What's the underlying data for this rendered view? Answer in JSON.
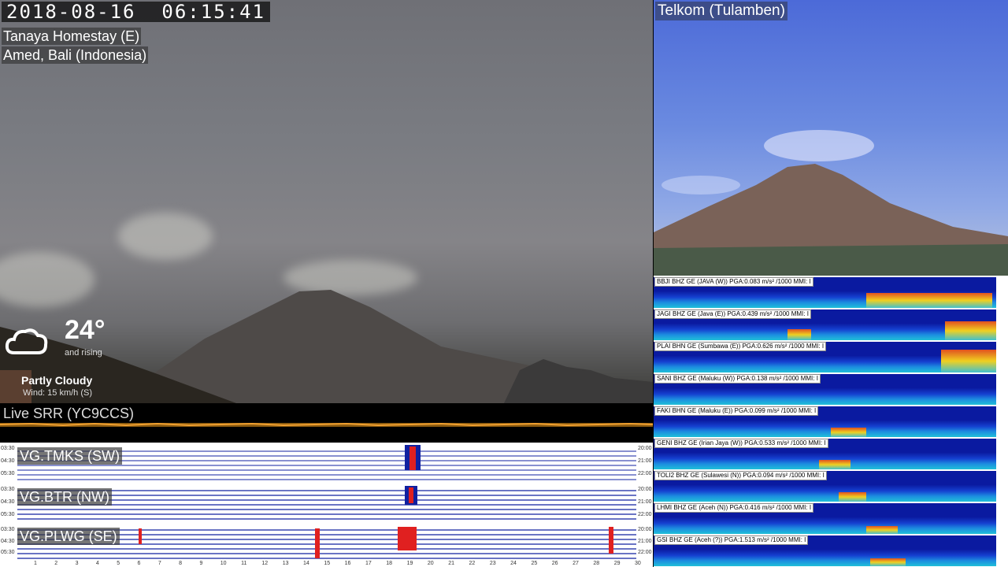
{
  "clock": "2018-08-16  06:15:41",
  "left_camera": {
    "location_line1": "Tanaya Homestay (E)",
    "location_line2": "Amed, Bali (Indonesia)"
  },
  "weather": {
    "icon": "partly-cloudy-icon",
    "temperature": "24°",
    "trend": "and rising",
    "condition": "Partly Cloudy",
    "wind": "Wind: 15 km/h (S)"
  },
  "right_camera": {
    "label": "Telkom (Tulamben)"
  },
  "srr": {
    "label": "Live SRR (YC9CCS)"
  },
  "seismograms": {
    "stations": [
      {
        "label": "VG.TMKS (SW)",
        "times_left": [
          "03:30",
          "04:30",
          "05:30"
        ],
        "times_right": [
          "20:00",
          "21:00",
          "22:00"
        ]
      },
      {
        "label": "VG.BTR (NW)",
        "times_left": [
          "03:30",
          "04:30",
          "05:30"
        ],
        "times_right": [
          "20:00",
          "21:00",
          "22:00"
        ]
      },
      {
        "label": "VG.PLWG (SE)",
        "times_left": [
          "03:30",
          "04:30",
          "05:30"
        ],
        "times_right": [
          "20:00",
          "21:00",
          "22:00"
        ]
      }
    ],
    "x_ticks": [
      "1",
      "2",
      "3",
      "4",
      "5",
      "6",
      "7",
      "8",
      "9",
      "10",
      "11",
      "12",
      "13",
      "14",
      "15",
      "16",
      "17",
      "18",
      "19",
      "20",
      "21",
      "22",
      "23",
      "24",
      "25",
      "26",
      "27",
      "28",
      "29",
      "30"
    ]
  },
  "spectrograms": [
    {
      "label": "BBJI BHZ GE (JAVA (W)) PGA:0.083 m/s² /1000 MMI: I"
    },
    {
      "label": "JAGI BHZ GE (Java (E)) PGA:0.439 m/s² /1000 MMI: I"
    },
    {
      "label": "PLAI BHN GE (Sumbawa (E)) PGA:0.626 m/s² /1000 MMI: I"
    },
    {
      "label": "SANI BHZ GE (Maluku (W)) PGA:0.138 m/s² /1000 MMI: I"
    },
    {
      "label": "FAKI BHN GE (Maluku (E)) PGA:0.099 m/s² /1000 MMI: I"
    },
    {
      "label": "GENI BHZ GE (Irian Jaya (W)) PGA:0.533 m/s² /1000 MMI: I"
    },
    {
      "label": "TOLI2 BHZ GE (Sulawesi (N)) PGA:0.094 m/s² /1000 MMI: I"
    },
    {
      "label": "LHMI BHZ GE (Aceh (N)) PGA:0.416 m/s² /1000 MMI: I"
    },
    {
      "label": "GSI BHZ GE (Aceh (?)) PGA:1.513 m/s² /1000 MMI: I"
    }
  ]
}
